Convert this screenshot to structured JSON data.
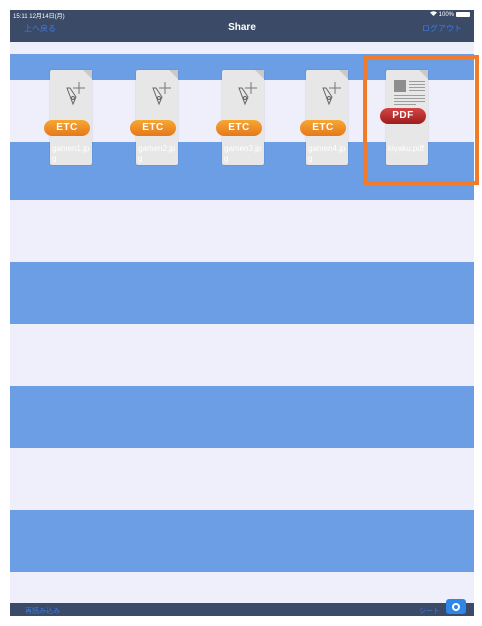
{
  "status": {
    "time": "15:11  12月14日(月)",
    "right": "100%"
  },
  "nav": {
    "back_label": "上へ戻る",
    "title": "Share",
    "logout_label": "ログアウト"
  },
  "files": [
    {
      "name": "gamen1.jpg",
      "badge": "ETC",
      "icon": "pen-nib-icon"
    },
    {
      "name": "gamen2.jpg",
      "badge": "ETC",
      "icon": "pen-nib-icon"
    },
    {
      "name": "gamen3.jpg",
      "badge": "ETC",
      "icon": "pen-nib-icon"
    },
    {
      "name": "gamen4.jpg",
      "badge": "ETC",
      "icon": "pen-nib-icon"
    },
    {
      "name": "kiyaku.pdf",
      "badge": "PDF",
      "icon": "pdf-document-icon"
    }
  ],
  "bottom": {
    "left_label": "再読み込み",
    "right_label": "シート",
    "camera_icon": "camera-icon"
  },
  "colors": {
    "stripe_blue": "#6c9ee6",
    "stripe_light": "#eeeffb",
    "bar": "#3b4a66",
    "link": "#3d7be0",
    "highlight": "#f07b2a"
  }
}
